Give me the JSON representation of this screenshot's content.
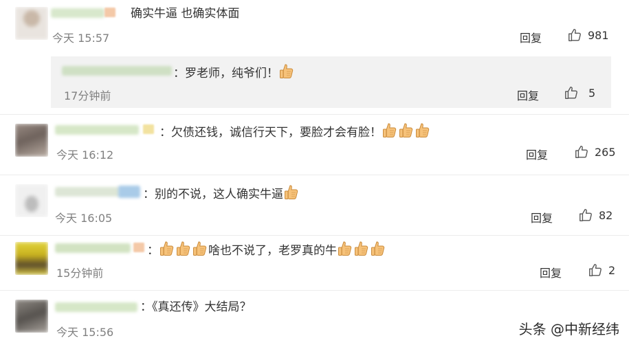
{
  "comments": [
    {
      "text": "确实牛逼 也确实体面",
      "time": "今天 15:57",
      "reply": "回复",
      "likes": "981"
    },
    {
      "text": "：罗老师，纯爷们！",
      "time": "17分钟前",
      "reply": "回复",
      "likes": "5"
    },
    {
      "text": "：欠债还钱，诚信行天下，要脸才会有脸！",
      "time": "今天 16:12",
      "reply": "回复",
      "likes": "265"
    },
    {
      "text": "：别的不说，这人确实牛逼",
      "time": "今天 16:05",
      "reply": "回复",
      "likes": "82"
    },
    {
      "text_a": "：",
      "text_b": "啥也不说了，老罗真的牛",
      "time": "15分钟前",
      "reply": "回复",
      "likes": "2"
    },
    {
      "text": "：《真还传》大结局？",
      "time": "今天 15:56"
    }
  ],
  "watermark": "头条 @中新经纬",
  "icons": {
    "like": "thumbs-up-outline-icon",
    "emoji": "thumbs-up-emoji-icon"
  },
  "colors": {
    "sub_reply_bg": "#f2f2f2",
    "time": "#808080",
    "text": "#333333"
  }
}
